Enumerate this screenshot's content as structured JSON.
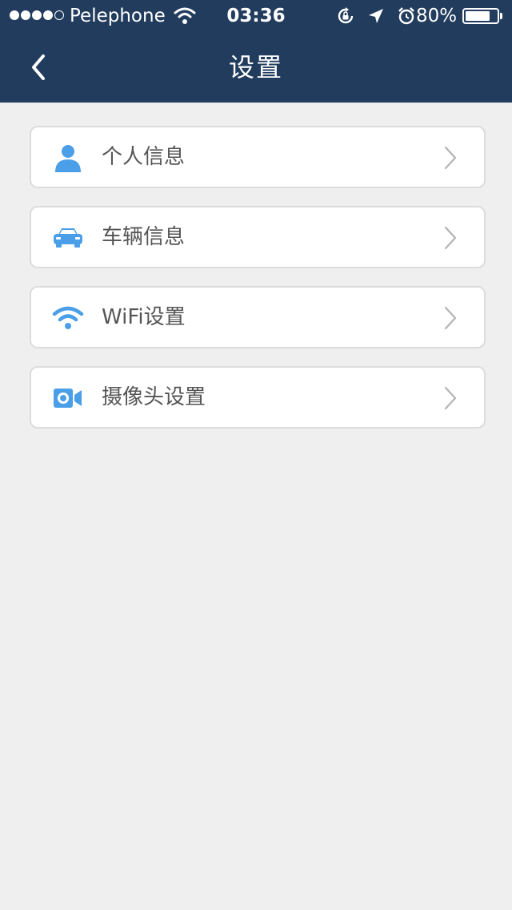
{
  "status_bar": {
    "carrier": "Pelephone",
    "time": "03:36",
    "battery_percent": "80%",
    "battery_level": 0.8,
    "signal_bars_filled": 4,
    "signal_bars_total": 5,
    "icons": [
      "wifi-icon",
      "rotation-lock-icon",
      "location-arrow-icon",
      "alarm-icon",
      "battery-icon"
    ]
  },
  "nav": {
    "title": "设置",
    "back_icon": "chevron-left-icon"
  },
  "settings": {
    "items": [
      {
        "label": "个人信息",
        "icon": "person-icon"
      },
      {
        "label": "车辆信息",
        "icon": "car-icon"
      },
      {
        "label": "WiFi设置",
        "icon": "wifi-icon"
      },
      {
        "label": "摄像头设置",
        "icon": "camera-icon"
      }
    ],
    "chevron_icon": "chevron-right-icon"
  },
  "colors": {
    "header_bg": "#223c5e",
    "page_bg": "#efefef",
    "accent_icon": "#4a9fe8",
    "label_text": "#555555",
    "chevron": "#b3b3b3"
  }
}
